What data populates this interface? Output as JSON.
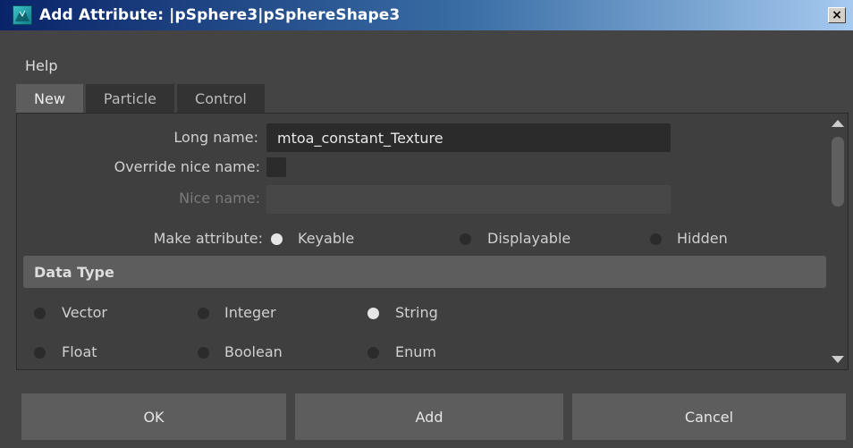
{
  "window": {
    "title": "Add Attribute: |pSphere3|pSphereShape3",
    "close_label": "×"
  },
  "menu": {
    "help": "Help"
  },
  "tabs": [
    {
      "label": "New",
      "active": true
    },
    {
      "label": "Particle",
      "active": false
    },
    {
      "label": "Control",
      "active": false
    }
  ],
  "form": {
    "long_name_label": "Long name:",
    "long_name_value": "mtoa_constant_Texture",
    "override_nice_name_label": "Override nice name:",
    "override_nice_name_checked": false,
    "nice_name_label": "Nice name:",
    "nice_name_value": "",
    "make_attribute_label": "Make attribute:",
    "make_attribute_options": [
      {
        "label": "Keyable",
        "selected": true
      },
      {
        "label": "Displayable",
        "selected": false
      },
      {
        "label": "Hidden",
        "selected": false
      }
    ]
  },
  "data_type": {
    "header": "Data Type",
    "options": [
      {
        "label": "Vector",
        "selected": false
      },
      {
        "label": "Integer",
        "selected": false
      },
      {
        "label": "String",
        "selected": true
      },
      {
        "label": "Float",
        "selected": false
      },
      {
        "label": "Boolean",
        "selected": false
      },
      {
        "label": "Enum",
        "selected": false
      }
    ]
  },
  "buttons": {
    "ok": "OK",
    "add": "Add",
    "cancel": "Cancel"
  },
  "colors": {
    "background": "#444444",
    "panel": "#3f3f3f",
    "field": "#2b2b2b",
    "button": "#5d5d5d",
    "title_gradient_start": "#0a246a",
    "title_gradient_end": "#a6caf0"
  }
}
